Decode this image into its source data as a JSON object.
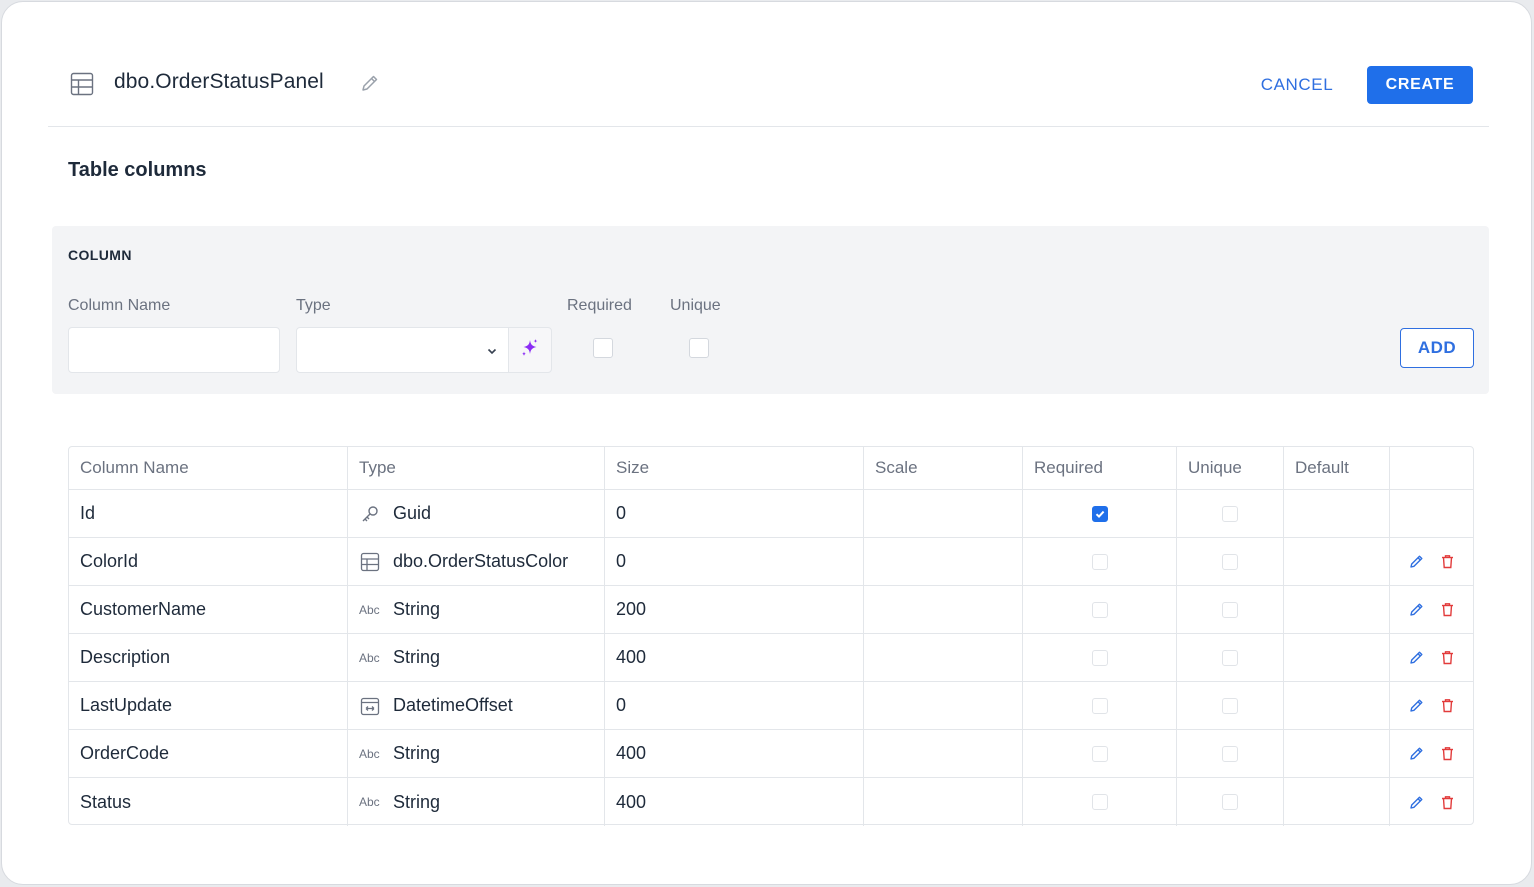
{
  "header": {
    "title": "dbo.OrderStatusPanel",
    "cancel_label": "CANCEL",
    "create_label": "CREATE"
  },
  "section_title": "Table columns",
  "column_form": {
    "label": "COLUMN",
    "name_label": "Column Name",
    "name_value": "",
    "type_label": "Type",
    "type_value": "",
    "required_label": "Required",
    "unique_label": "Unique",
    "required_checked": false,
    "unique_checked": false,
    "add_label": "ADD"
  },
  "table": {
    "headers": [
      "Column Name",
      "Type",
      "Size",
      "Scale",
      "Required",
      "Unique",
      "Default",
      ""
    ],
    "rows": [
      {
        "name": "Id",
        "type_icon": "key-icon",
        "type": "Guid",
        "size": "0",
        "scale": "",
        "required": true,
        "unique": false,
        "default": "",
        "actions": false
      },
      {
        "name": "ColorId",
        "type_icon": "table-icon",
        "type": "dbo.OrderStatusColor",
        "size": "0",
        "scale": "",
        "required": false,
        "unique": false,
        "default": "",
        "actions": true
      },
      {
        "name": "CustomerName",
        "type_icon": "abc-icon",
        "type": "String",
        "size": "200",
        "scale": "",
        "required": false,
        "unique": false,
        "default": "",
        "actions": true
      },
      {
        "name": "Description",
        "type_icon": "abc-icon",
        "type": "String",
        "size": "400",
        "scale": "",
        "required": false,
        "unique": false,
        "default": "",
        "actions": true
      },
      {
        "name": "LastUpdate",
        "type_icon": "calendar-icon",
        "type": "DatetimeOffset",
        "size": "0",
        "scale": "",
        "required": false,
        "unique": false,
        "default": "",
        "actions": true
      },
      {
        "name": "OrderCode",
        "type_icon": "abc-icon",
        "type": "String",
        "size": "400",
        "scale": "",
        "required": false,
        "unique": false,
        "default": "",
        "actions": true
      },
      {
        "name": "Status",
        "type_icon": "abc-icon",
        "type": "String",
        "size": "400",
        "scale": "",
        "required": false,
        "unique": false,
        "default": "",
        "actions": true
      }
    ]
  },
  "icon_labels": {
    "abc": "Abc"
  },
  "colors": {
    "primary": "#1f6fea",
    "danger": "#e23b3b",
    "ai_accent": "#8b2cf5"
  }
}
